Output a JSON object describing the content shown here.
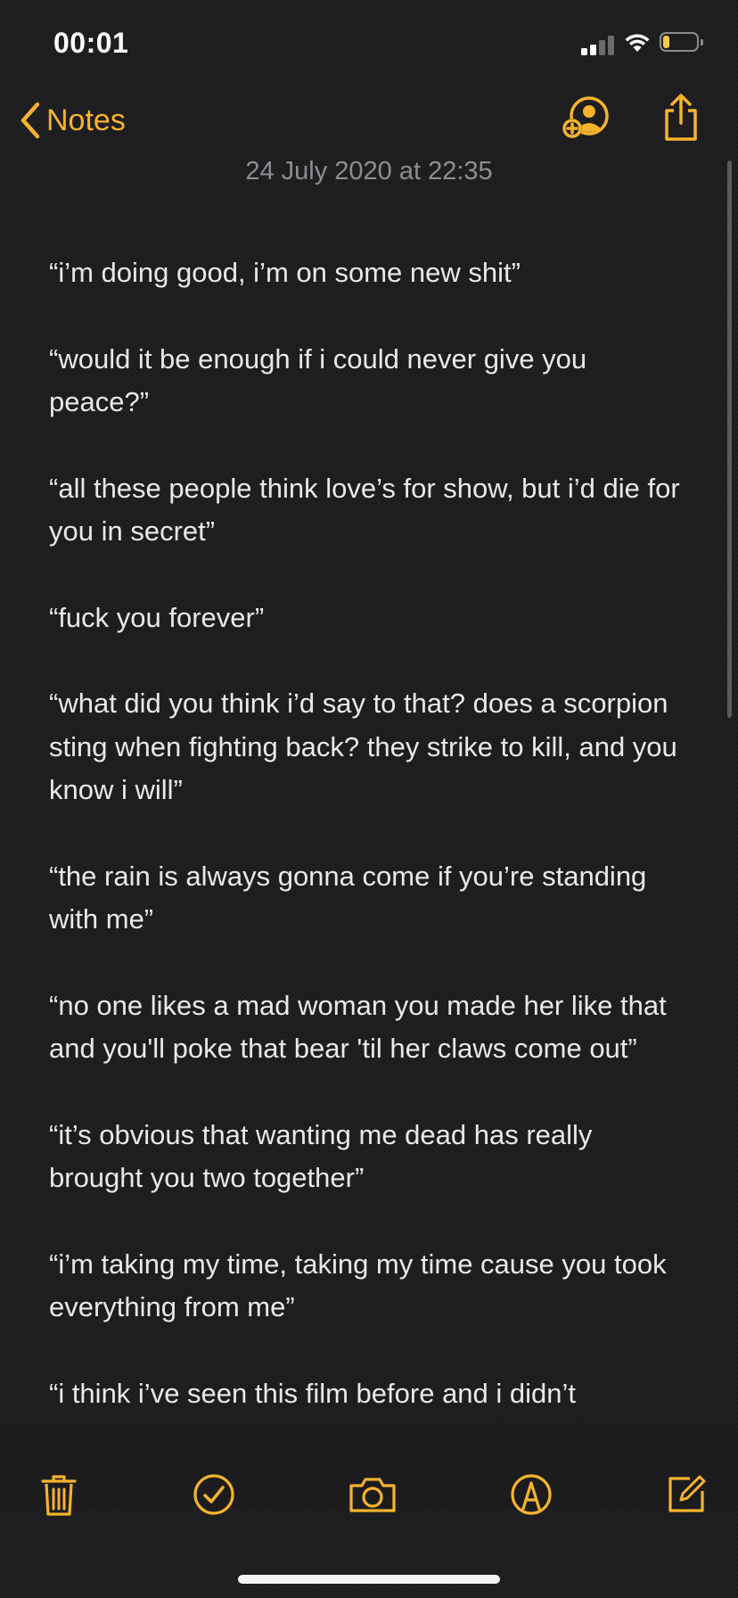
{
  "status": {
    "time": "00:01",
    "battery_level": 0.2,
    "signal_bars": 2
  },
  "nav": {
    "back_label": "Notes",
    "icons": [
      "chevron-left-icon",
      "add-person-icon",
      "share-icon"
    ]
  },
  "note": {
    "date": "24 July 2020 at 22:35",
    "lines": [
      "“i’m doing good, i’m on some new shit”",
      "“would it be enough if i could never give you peace?”",
      "“all these people think love’s for show, but i’d die for you in secret”",
      "“fuck you forever”",
      "“what did you think i’d say to that? does a scorpion sting when fighting back? they strike to kill, and you know i will”",
      "“the rain is always gonna come if you’re standing with me”",
      "“no one likes a mad woman you made her like that and you'll poke that bear 'til her claws come out”",
      "“it’s obvious that wanting me dead has really brought you two together”",
      "“i’m taking my time, taking my time cause you took everything from me”",
      "“i think i’ve seen this film before and i didn’t"
    ]
  },
  "toolbar": {
    "icons": [
      "trash-icon",
      "checklist-icon",
      "camera-icon",
      "markup-icon",
      "compose-icon"
    ]
  },
  "colors": {
    "accent": "#f5b32d",
    "background": "#1c1c1e",
    "text": "#e9e9e9",
    "secondary": "#8e8e93"
  }
}
